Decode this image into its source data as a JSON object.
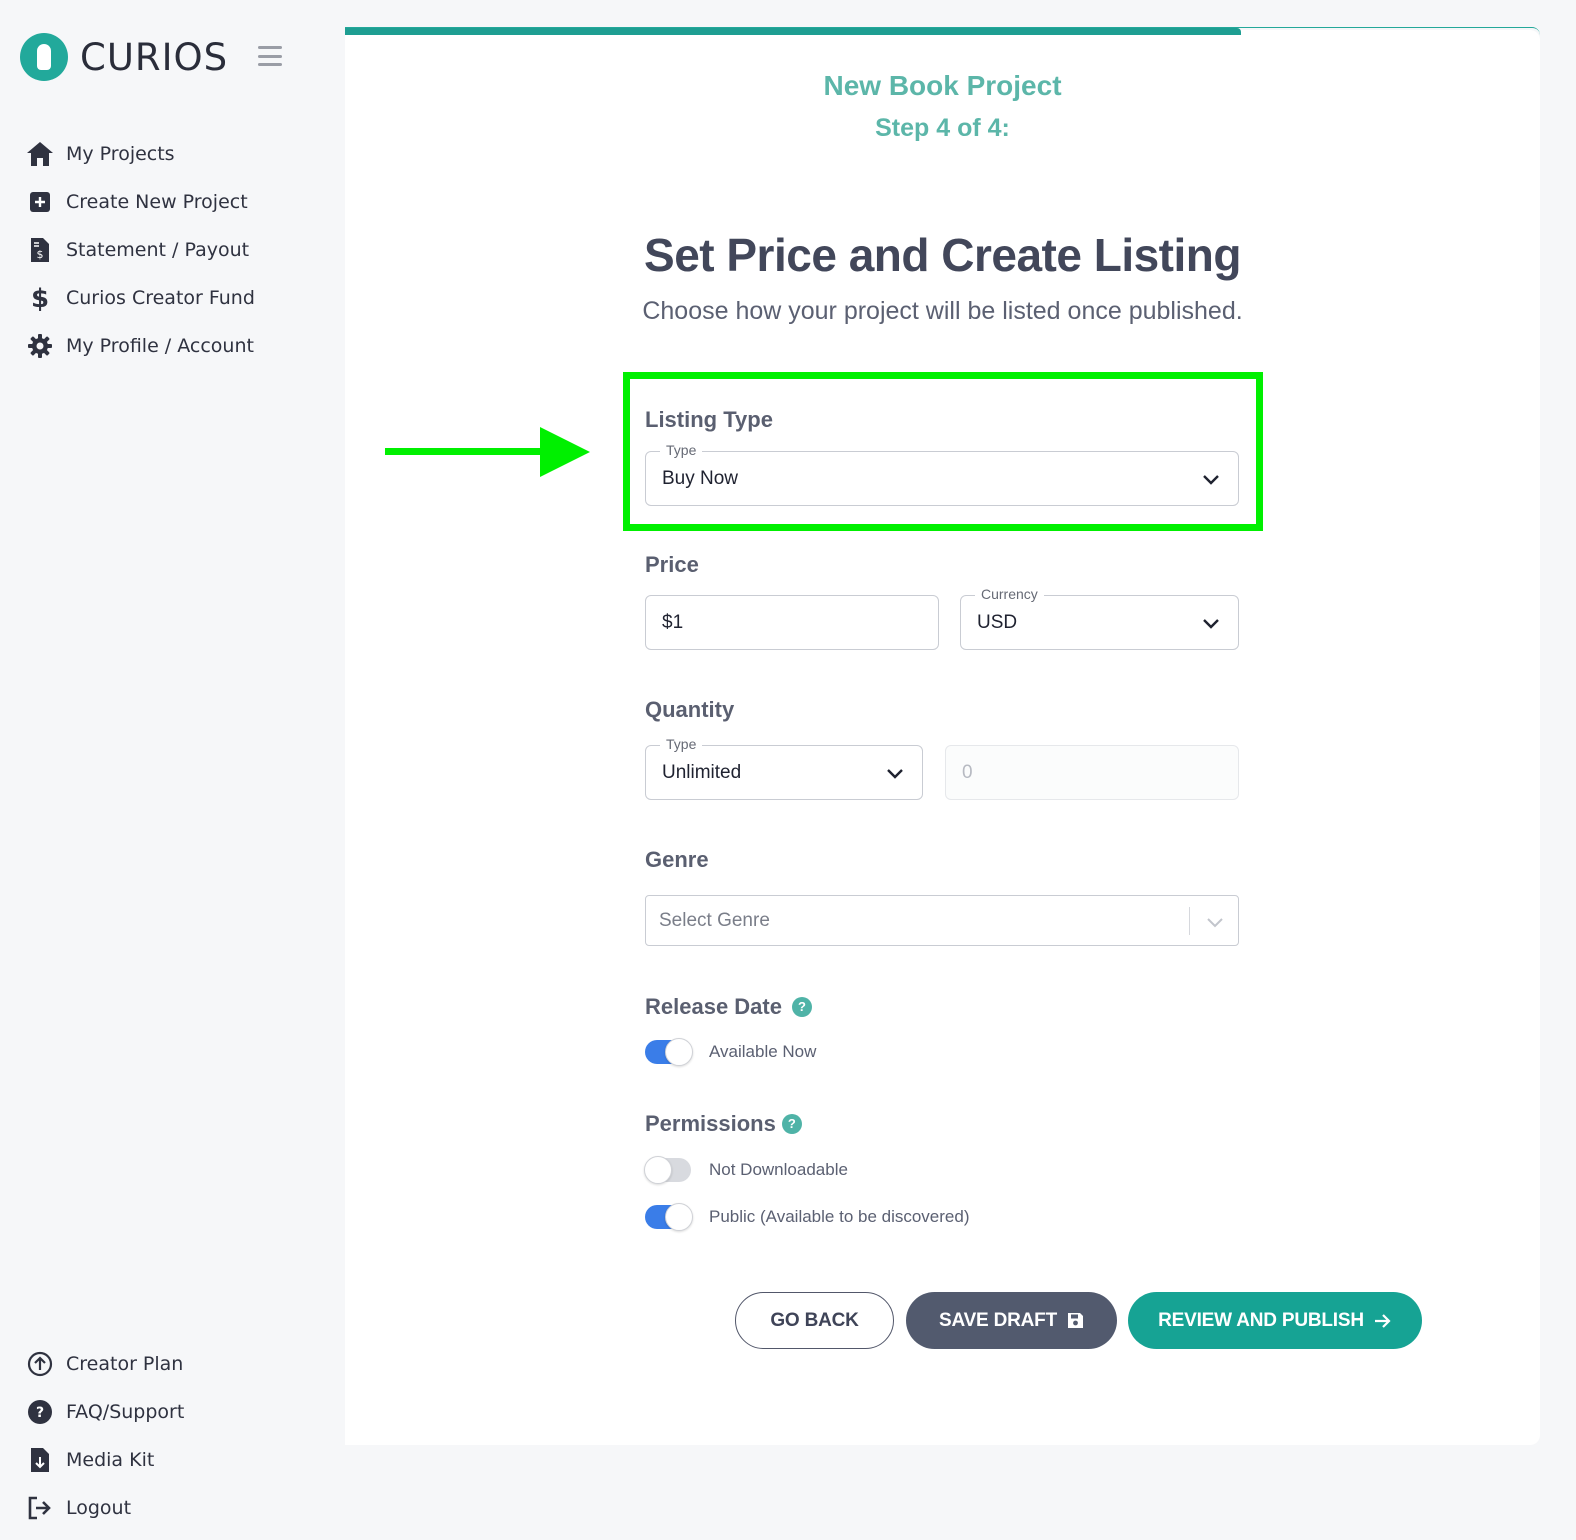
{
  "brand": {
    "name": "CURIOS",
    "accent": "#22a99b"
  },
  "sidebar": {
    "top_items": [
      {
        "label": "My Projects",
        "icon": "home-icon"
      },
      {
        "label": "Create New Project",
        "icon": "plus-square-icon"
      },
      {
        "label": "Statement / Payout",
        "icon": "invoice-icon"
      },
      {
        "label": "Curios Creator Fund",
        "icon": "dollar-icon"
      },
      {
        "label": "My Profile / Account",
        "icon": "gear-icon"
      }
    ],
    "bottom_items": [
      {
        "label": "Creator Plan",
        "icon": "upgrade-circle-icon"
      },
      {
        "label": "FAQ/Support",
        "icon": "question-circle-icon"
      },
      {
        "label": "Media Kit",
        "icon": "file-download-icon"
      },
      {
        "label": "Logout",
        "icon": "logout-icon"
      }
    ]
  },
  "progress": {
    "step": 4,
    "total": 4,
    "fraction": 0.75
  },
  "header": {
    "project_title": "New Book Project",
    "step_label": "Step 4 of 4:",
    "title": "Set Price and Create Listing",
    "subtitle": "Choose how your project will be listed once published."
  },
  "form": {
    "listing_type": {
      "section": "Listing Type",
      "legend": "Type",
      "value": "Buy Now"
    },
    "price": {
      "section": "Price",
      "value": "$1",
      "currency_legend": "Currency",
      "currency_value": "USD"
    },
    "quantity": {
      "section": "Quantity",
      "legend": "Type",
      "value": "Unlimited",
      "amount_placeholder": "0"
    },
    "genre": {
      "section": "Genre",
      "placeholder": "Select Genre"
    },
    "release_date": {
      "section": "Release Date",
      "help": "?",
      "toggle_label": "Available Now",
      "enabled": true
    },
    "permissions": {
      "section": "Permissions",
      "help": "?",
      "downloadable": {
        "label": "Not Downloadable",
        "enabled": false
      },
      "public": {
        "label": "Public (Available to be discovered)",
        "enabled": true
      }
    }
  },
  "actions": {
    "back": "GO BACK",
    "save": "SAVE DRAFT",
    "publish": "REVIEW AND PUBLISH"
  },
  "annotation": {
    "highlight_color": "#00f000"
  }
}
